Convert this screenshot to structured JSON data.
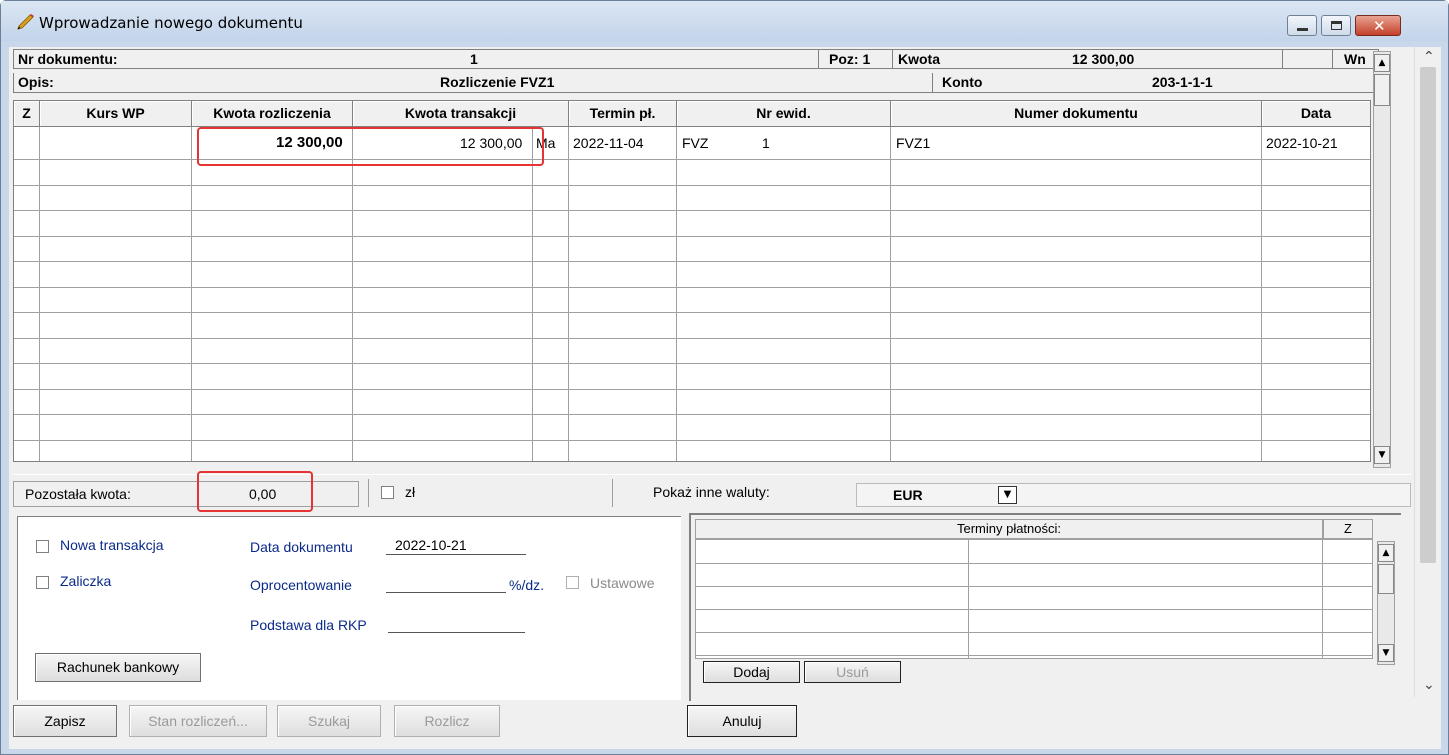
{
  "window": {
    "title": "Wprowadzanie nowego dokumentu"
  },
  "header": {
    "nr_label": "Nr dokumentu:",
    "nr_value": "1",
    "poz": "Poz: 1",
    "kwota_label": "Kwota",
    "kwota_value": "12 300,00",
    "side": "Wn",
    "opis_label": "Opis:",
    "opis_value": "Rozliczenie FVZ1",
    "konto_label": "Konto",
    "konto_value": "203-1-1-1"
  },
  "table": {
    "columns": [
      "Z",
      "Kurs WP",
      "Kwota rozliczenia",
      "Kwota transakcji",
      "Termin pł.",
      "Nr ewid.",
      "Numer dokumentu",
      "Data"
    ],
    "row": {
      "kwota_rozliczenia": "12 300,00",
      "kwota_transakcji": "12 300,00",
      "side": "Ma",
      "termin": "2022-11-04",
      "nr_ewid_prefix": "FVZ",
      "nr_ewid_num": "1",
      "numer_dokumentu": "FVZ1",
      "data": "2022-10-21"
    }
  },
  "summary": {
    "pozostala_label": "Pozostała kwota:",
    "pozostala_value": "0,00",
    "zl_label": "zł",
    "waluty_label": "Pokaż inne waluty:",
    "waluta": "EUR"
  },
  "form": {
    "nowa_transakcja": "Nowa transakcja",
    "zaliczka": "Zaliczka",
    "data_dok_label": "Data dokumentu",
    "data_dok_value": "2022-10-21",
    "oprocentowanie_label": "Oprocentowanie",
    "procent_unit": "%/dz.",
    "ustawowe": "Ustawowe",
    "podstawa_label": "Podstawa dla RKP",
    "rachunek_button": "Rachunek bankowy"
  },
  "terms": {
    "header": "Terminy płatności:",
    "z": "Z",
    "dodaj": "Dodaj",
    "usun": "Usuń"
  },
  "footer": {
    "zapisz": "Zapisz",
    "stan": "Stan rozliczeń...",
    "szukaj": "Szukaj",
    "rozlicz": "Rozlicz",
    "anuluj": "Anuluj"
  }
}
